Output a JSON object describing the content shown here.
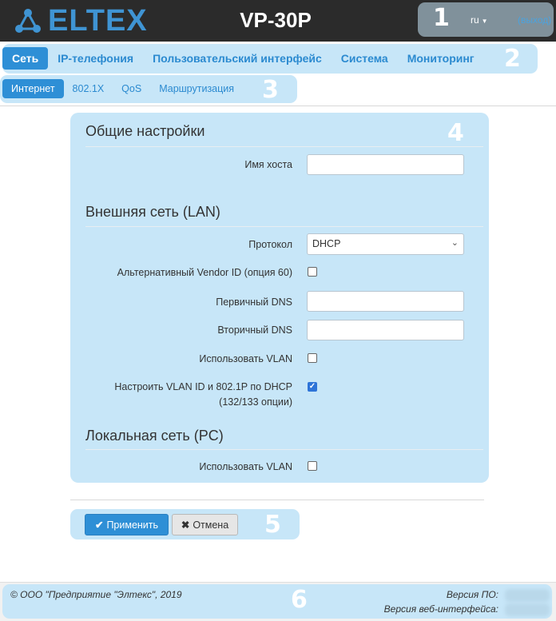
{
  "header": {
    "logo_text": "ELTEX",
    "device": "VP-30P",
    "lang": "ru",
    "logout": "(выход)",
    "accent": "#3f94d3"
  },
  "markers": [
    "1",
    "2",
    "3",
    "4",
    "5",
    "6"
  ],
  "main_tabs": [
    {
      "label": "Сеть",
      "active": true
    },
    {
      "label": "IP-телефония",
      "active": false
    },
    {
      "label": "Пользовательский интерфейс",
      "active": false
    },
    {
      "label": "Система",
      "active": false
    },
    {
      "label": "Мониторинг",
      "active": false
    }
  ],
  "sub_tabs": [
    {
      "label": "Интернет",
      "active": true
    },
    {
      "label": "802.1X",
      "active": false
    },
    {
      "label": "QoS",
      "active": false
    },
    {
      "label": "Маршрутизация",
      "active": false
    }
  ],
  "form": {
    "general_title": "Общие настройки",
    "hostname_label": "Имя хоста",
    "hostname_value": "",
    "wan_title": "Внешняя сеть (LAN)",
    "protocol_label": "Протокол",
    "protocol_value": "DHCP",
    "alt_vendor_label": "Альтернативный Vendor ID (опция 60)",
    "alt_vendor_checked": false,
    "dns1_label": "Первичный DNS",
    "dns1_value": "",
    "dns2_label": "Вторичный DNS",
    "dns2_value": "",
    "use_vlan_label": "Использовать VLAN",
    "use_vlan_checked": false,
    "dhcp_vlan_label_1": "Настроить VLAN ID и 802.1P по DHCP",
    "dhcp_vlan_label_2": "(132/133 опции)",
    "dhcp_vlan_checked": true,
    "lan_title": "Локальная сеть (PC)",
    "lan_use_vlan_label": "Использовать VLAN",
    "lan_use_vlan_checked": false
  },
  "buttons": {
    "apply": "Применить",
    "cancel": "Отмена"
  },
  "footer": {
    "copyright": "© ООО \"Предприятие \"Элтекс\", 2019",
    "fw_label": "Версия ПО:",
    "web_label": "Версия веб-интерфейса:"
  }
}
